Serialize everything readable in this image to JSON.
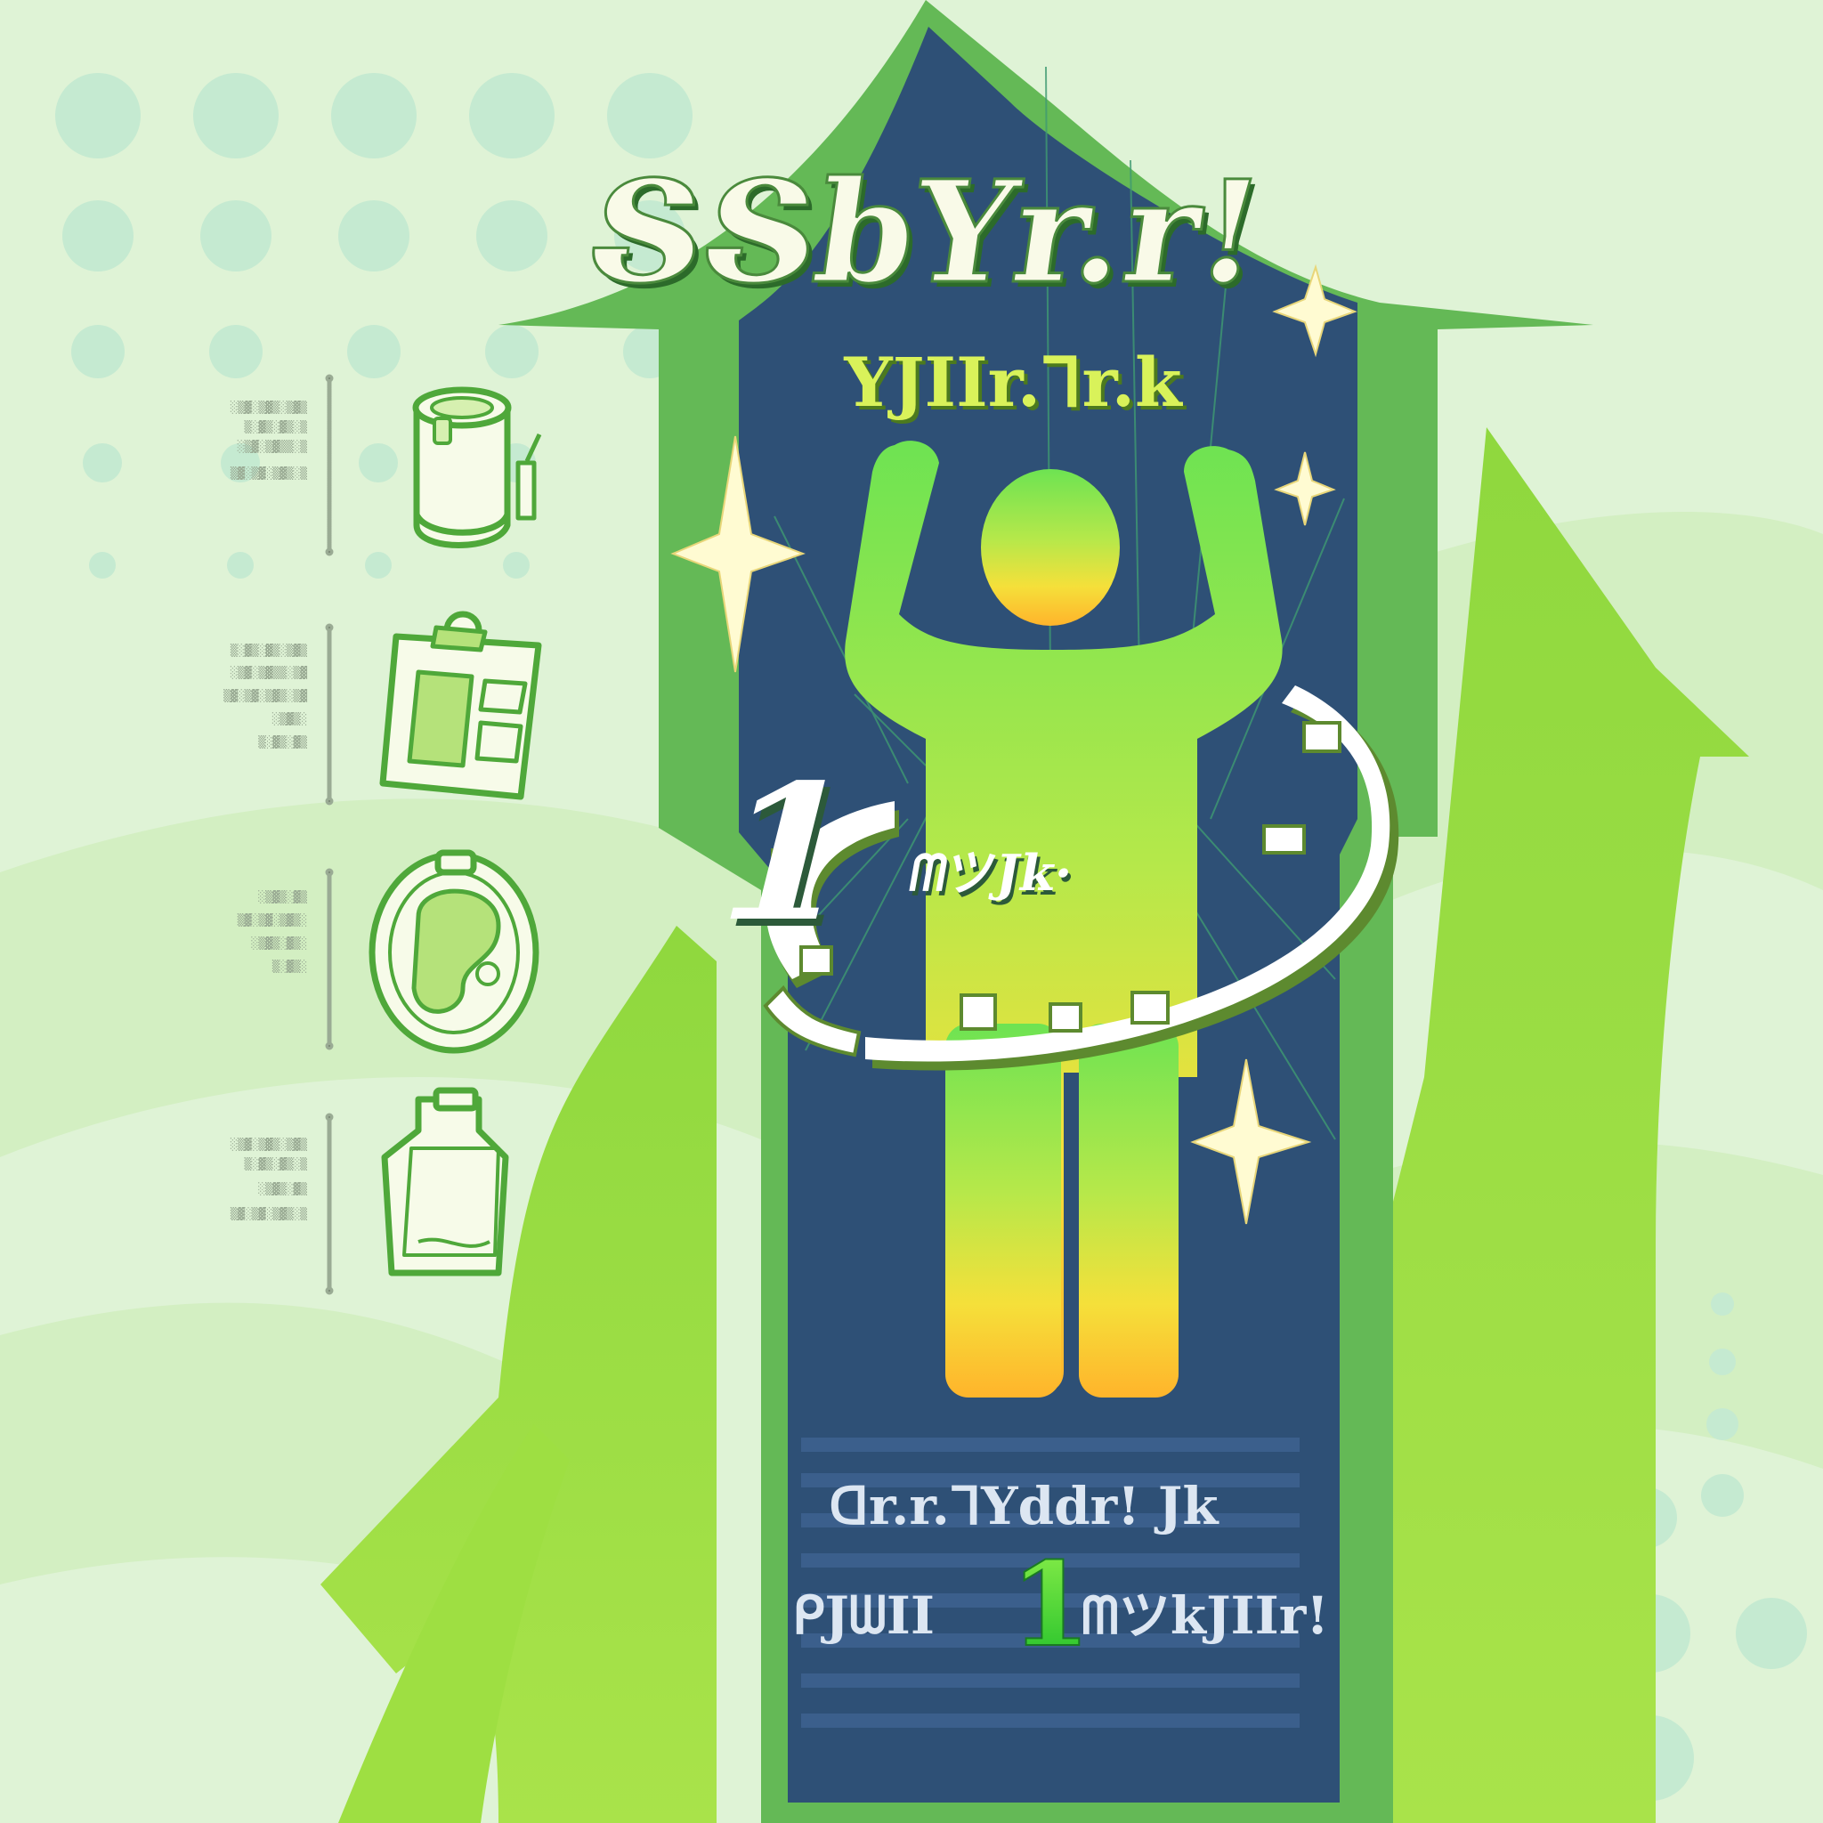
{
  "poster": {
    "title_line1": "ՏՏbYr.r!",
    "title_line2": "YJIIr.ᒣr.k",
    "badge_number": "1",
    "badge_text": "ᗰツJk·",
    "footer_line1": "ᗡr.r.ᒣYddr! Jk",
    "footer_line2_left": "ᑭJᗯII",
    "footer_number": "1",
    "footer_line2_right": "ᗰツkJIIr!"
  },
  "sidebar": {
    "items": [
      {
        "icon": "canned-food-icon",
        "lines": [
          "░▒▓░▒▓▒░▒▓▒",
          "▒░▓▒░▓▒░▒",
          "░▒▓░▒▓▒▒░▒",
          "▒▓░▒▓░▒▓▒░▒"
        ]
      },
      {
        "icon": "clipboard-icon",
        "lines": [
          "▒░▓▒░▓▒░▒▓▒",
          "░▒▓░▒▓▒▒░▒▓",
          "▒▓░▒▓░▒▓▒░▒▓",
          "░▒▓▒░",
          "▒░▓▒░▓▒"
        ]
      },
      {
        "icon": "fish-bowl-icon",
        "lines": [
          "░▒▓▒░▓▒",
          "▒▓░▒▓░▒▓▒░",
          "░▒▓▒░▓▒░",
          "▒░▓▒░"
        ]
      },
      {
        "icon": "bottle-icon",
        "lines": [
          "░▒▓░▒▓▒░▒▓▒",
          "▒░▓▒░▓▒░▒",
          "░▒▓▒░▓▒",
          "▒▓░▒▓░▒▓▒░▒"
        ]
      }
    ]
  },
  "colors": {
    "background": "#dff3d6",
    "arrow_green": "#64b956",
    "panel_navy": "#2e5076",
    "figure_green": "#6ee352",
    "figure_yellow": "#f5e03a",
    "figure_orange": "#ffb42b",
    "sparkle": "#fffbd2",
    "title_cream": "#f9fae8",
    "subtitle_yellow": "#d9f25a"
  }
}
